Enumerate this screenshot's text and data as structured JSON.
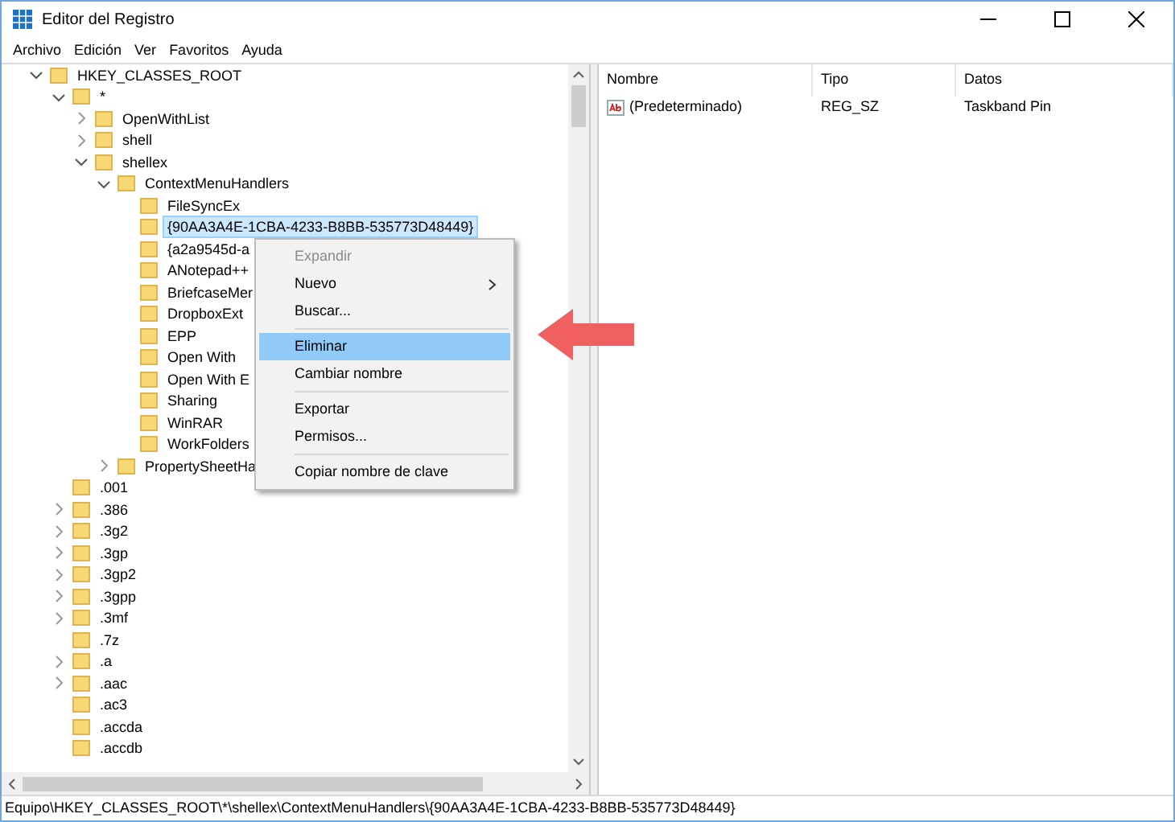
{
  "window": {
    "title": "Editor del Registro"
  },
  "menu_bar": [
    "Archivo",
    "Edición",
    "Ver",
    "Favoritos",
    "Ayuda"
  ],
  "tree": [
    {
      "label": "HKEY_CLASSES_ROOT",
      "expanded": true,
      "selected": false,
      "children": [
        {
          "label": "*",
          "expanded": true,
          "selected": false,
          "children": [
            {
              "label": "OpenWithList",
              "expanded": false,
              "selected": false
            },
            {
              "label": "shell",
              "expanded": false,
              "selected": false
            },
            {
              "label": "shellex",
              "expanded": true,
              "selected": false,
              "children": [
                {
                  "label": "ContextMenuHandlers",
                  "expanded": true,
                  "selected": false,
                  "children": [
                    {
                      "label": "FileSyncEx",
                      "selected": false
                    },
                    {
                      "label": "{90AA3A4E-1CBA-4233-B8BB-535773D48449}",
                      "selected": true
                    },
                    {
                      "label": "{a2a9545d-a",
                      "selected": false
                    },
                    {
                      "label": "ANotepad++",
                      "selected": false
                    },
                    {
                      "label": "BriefcaseMer",
                      "selected": false
                    },
                    {
                      "label": "DropboxExt",
                      "selected": false
                    },
                    {
                      "label": "EPP",
                      "selected": false
                    },
                    {
                      "label": "Open With",
                      "selected": false
                    },
                    {
                      "label": "Open With E",
                      "selected": false
                    },
                    {
                      "label": "Sharing",
                      "selected": false
                    },
                    {
                      "label": "WinRAR",
                      "selected": false
                    },
                    {
                      "label": "WorkFolders",
                      "selected": false
                    }
                  ]
                },
                {
                  "label": "PropertySheetHa",
                  "expanded": false,
                  "selected": false
                }
              ]
            }
          ]
        },
        {
          "label": ".001",
          "selected": false
        },
        {
          "label": ".386",
          "expanded": false,
          "selected": false
        },
        {
          "label": ".3g2",
          "expanded": false,
          "selected": false
        },
        {
          "label": ".3gp",
          "expanded": false,
          "selected": false
        },
        {
          "label": ".3gp2",
          "expanded": false,
          "selected": false
        },
        {
          "label": ".3gpp",
          "expanded": false,
          "selected": false
        },
        {
          "label": ".3mf",
          "expanded": false,
          "selected": false
        },
        {
          "label": ".7z",
          "selected": false
        },
        {
          "label": ".a",
          "expanded": false,
          "selected": false
        },
        {
          "label": ".aac",
          "expanded": false,
          "selected": false
        },
        {
          "label": ".ac3",
          "selected": false
        },
        {
          "label": ".accda",
          "selected": false
        },
        {
          "label": ".accdb",
          "selected": false
        }
      ]
    }
  ],
  "values": {
    "columns": [
      "Nombre",
      "Tipo",
      "Datos"
    ],
    "rows": [
      {
        "name": "(Predeterminado)",
        "type": "REG_SZ",
        "data": "Taskband Pin"
      }
    ]
  },
  "context_menu": [
    {
      "kind": "item",
      "label": "Expandir",
      "disabled": true,
      "selected": false,
      "submenu": false
    },
    {
      "kind": "item",
      "label": "Nuevo",
      "disabled": false,
      "selected": false,
      "submenu": true
    },
    {
      "kind": "item",
      "label": "Buscar...",
      "disabled": false,
      "selected": false,
      "submenu": false
    },
    {
      "kind": "separator"
    },
    {
      "kind": "item",
      "label": "Eliminar",
      "disabled": false,
      "selected": true,
      "submenu": false
    },
    {
      "kind": "item",
      "label": "Cambiar nombre",
      "disabled": false,
      "selected": false,
      "submenu": false
    },
    {
      "kind": "separator"
    },
    {
      "kind": "item",
      "label": "Exportar",
      "disabled": false,
      "selected": false,
      "submenu": false
    },
    {
      "kind": "item",
      "label": "Permisos...",
      "disabled": false,
      "selected": false,
      "submenu": false
    },
    {
      "kind": "separator"
    },
    {
      "kind": "item",
      "label": "Copiar nombre de clave",
      "disabled": false,
      "selected": false,
      "submenu": false
    }
  ],
  "status_bar": "Equipo\\HKEY_CLASSES_ROOT\\*\\shellex\\ContextMenuHandlers\\{90AA3A4E-1CBA-4233-B8BB-535773D48449}"
}
